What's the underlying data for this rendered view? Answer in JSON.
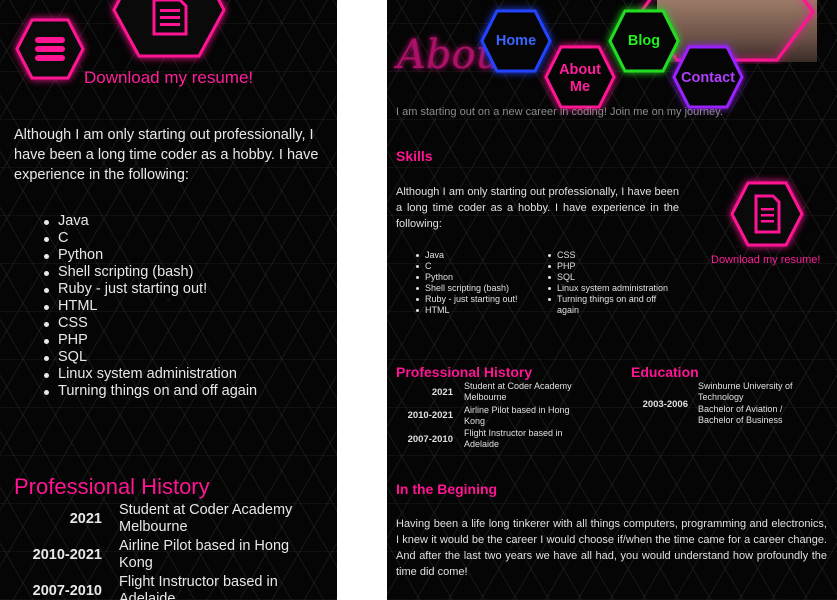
{
  "colors": {
    "accent": "#ff1493",
    "home": "#2244ff",
    "blog": "#22dd22",
    "contact": "#9922ff",
    "background": "#050505",
    "text": "#e8e8e8"
  },
  "left": {
    "menu_icon": "hamburger-menu-icon",
    "resume_icon": "document-icon",
    "download_label": "Download my resume!",
    "intro": "Although I am only starting out professionally, I have been a long time coder as a hobby. I have experience in the following:",
    "skills": [
      "Java",
      "C",
      "Python",
      "Shell scripting (bash)",
      "Ruby - just starting out!",
      "HTML",
      "CSS",
      "PHP",
      "SQL",
      "Linux system administration",
      "Turning things on and off again"
    ],
    "prof_title": "Professional History",
    "history": [
      {
        "year": "2021",
        "desc": "Student at Coder Academy Melbourne"
      },
      {
        "year": "2010-2021",
        "desc": "Airline Pilot based in Hong Kong"
      },
      {
        "year": "2007-2010",
        "desc": "Flight Instructor based in Adelaide"
      }
    ]
  },
  "right": {
    "about_script": "About",
    "nav": {
      "home": "Home",
      "blog": "Blog",
      "about": "About Me",
      "contact": "Contact"
    },
    "tagline": "I am starting out on a new career in coding! Join me on my journey.",
    "skills_title": "Skills",
    "intro": "Although I am only starting out professionally, I have been a long time coder as a hobby. I have experience in the following:",
    "skills_col1": [
      "Java",
      "C",
      "Python",
      "Shell scripting (bash)",
      "Ruby - just starting out!",
      "HTML"
    ],
    "skills_col2": [
      "CSS",
      "PHP",
      "SQL",
      "Linux system administration",
      "Turning things on and off again"
    ],
    "download_label": "Download my resume!",
    "resume_icon": "document-icon",
    "prof_title": "Professional History",
    "history": [
      {
        "year": "2021",
        "desc": "Student at Coder Academy Melbourne"
      },
      {
        "year": "2010-2021",
        "desc": "Airline Pilot based in Hong Kong"
      },
      {
        "year": "2007-2010",
        "desc": "Flight Instructor based in Adelaide"
      }
    ],
    "edu_title": "Education",
    "education": [
      {
        "year": "",
        "desc": "Swinburne University of Technology"
      },
      {
        "year": "2003-2006",
        "desc": "Bachelor of Aviation / Bachelor of Business"
      }
    ],
    "story_title": "In the Begining",
    "story": "Having been a life long tinkerer with all things computers, programming and electronics, I knew it would be the career I would choose if/when the time came for a career change. And after the last two years we have all had, you would understand how profoundly the time did come!"
  }
}
